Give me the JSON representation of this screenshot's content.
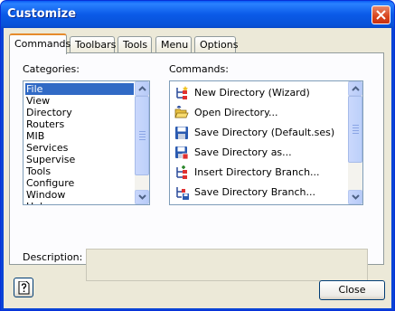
{
  "window": {
    "title": "Customize"
  },
  "tabs": [
    {
      "label": "Commands",
      "active": true
    },
    {
      "label": "Toolbars",
      "active": false
    },
    {
      "label": "Tools",
      "active": false
    },
    {
      "label": "Menu",
      "active": false
    },
    {
      "label": "Options",
      "active": false
    }
  ],
  "categories": {
    "label": "Categories:",
    "items": [
      "File",
      "View",
      "Directory",
      "Routers",
      "MIB",
      "Services",
      "Supervise",
      "Tools",
      "Configure",
      "Window",
      "Help"
    ],
    "selected": "File"
  },
  "commands": {
    "label": "Commands:",
    "items": [
      {
        "label": "New Directory (Wizard)",
        "icon": "new-directory-wizard-icon"
      },
      {
        "label": "Open Directory...",
        "icon": "open-folder-icon"
      },
      {
        "label": "Save Directory (Default.ses)",
        "icon": "floppy-disk-icon"
      },
      {
        "label": "Save Directory as...",
        "icon": "floppy-disk-save-as-icon"
      },
      {
        "label": "Insert Directory Branch...",
        "icon": "insert-branch-icon"
      },
      {
        "label": "Save Directory Branch...",
        "icon": "save-branch-icon"
      }
    ]
  },
  "description": {
    "label": "Description:",
    "value": ""
  },
  "footer": {
    "help_icon": "help-question-icon",
    "close_label": "Close"
  },
  "colors": {
    "titlebar": "#0a5ae8",
    "selection": "#316ac5",
    "dialog_bg": "#ece9d8",
    "tab_highlight": "#e68b2c"
  }
}
